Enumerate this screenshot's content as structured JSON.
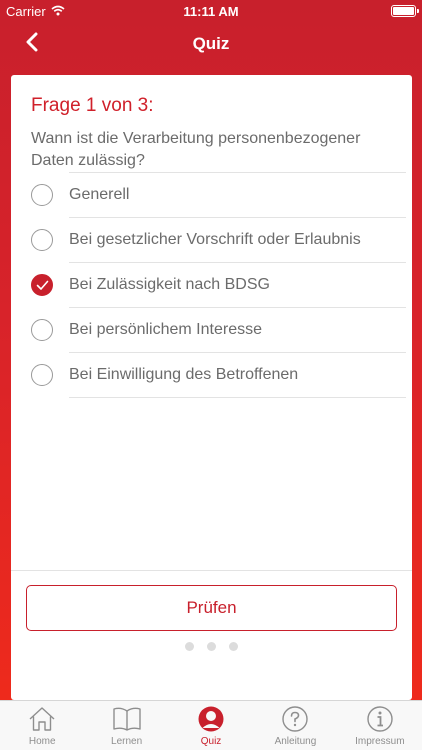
{
  "status_bar": {
    "carrier": "Carrier",
    "time": "11:11 AM"
  },
  "nav": {
    "title": "Quiz",
    "back_icon": "chevron-left-icon"
  },
  "question": {
    "heading": "Frage 1 von 3:",
    "text": "Wann ist die Verarbeitung personenbezogener Daten zulässig?"
  },
  "options": [
    {
      "label": "Generell",
      "selected": false
    },
    {
      "label": "Bei gesetzlicher Vorschrift oder Erlaubnis",
      "selected": false
    },
    {
      "label": "Bei Zulässigkeit nach BDSG",
      "selected": true
    },
    {
      "label": "Bei persönlichem Interesse",
      "selected": false
    },
    {
      "label": "Bei Einwilligung des Betroffenen",
      "selected": false
    }
  ],
  "check_button": {
    "label": "Prüfen"
  },
  "page_indicator": {
    "pages": 3
  },
  "tabs": [
    {
      "label": "Home",
      "icon": "home-icon",
      "active": false
    },
    {
      "label": "Lernen",
      "icon": "book-icon",
      "active": false
    },
    {
      "label": "Quiz",
      "icon": "person-icon",
      "active": true
    },
    {
      "label": "Anleitung",
      "icon": "question-icon",
      "active": false
    },
    {
      "label": "Impressum",
      "icon": "info-icon",
      "active": false
    }
  ],
  "colors": {
    "accent": "#c8202c",
    "text_gray": "#6b6b6b",
    "tab_inactive": "#8e8e8e"
  }
}
